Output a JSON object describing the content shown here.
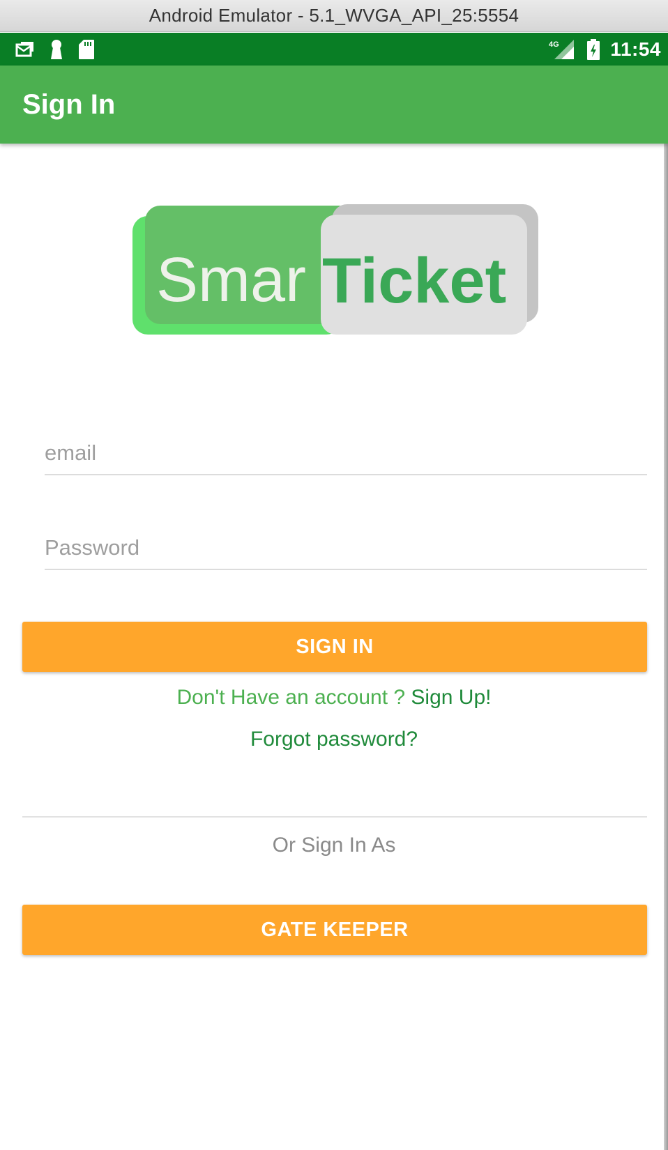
{
  "window": {
    "title": "Android Emulator - 5.1_WVGA_API_25:5554"
  },
  "status_bar": {
    "left_icons": [
      "email-notification-icon",
      "keyhole-icon",
      "sd-card-icon"
    ],
    "network": "4G",
    "right_icons": [
      "signal-icon",
      "battery-icon"
    ],
    "time": "11:54",
    "color": "#097e25"
  },
  "app_bar": {
    "title": "Sign In",
    "color": "#4cb050"
  },
  "logo": {
    "text_left": "Smar",
    "text_right": "Ticket"
  },
  "form": {
    "email_placeholder": "email",
    "password_placeholder": "Password",
    "sign_in_label": "SIGN IN",
    "signup_prompt": "Don't Have an account ? ",
    "signup_link": "Sign Up!",
    "forgot_password": "Forgot password?",
    "or_sign_in_as": "Or Sign In As",
    "gate_keeper_label": "GATE KEEPER"
  },
  "colors": {
    "button": "#ffa62b",
    "accent_green": "#4cb050",
    "link_green": "#1f8a3a"
  }
}
